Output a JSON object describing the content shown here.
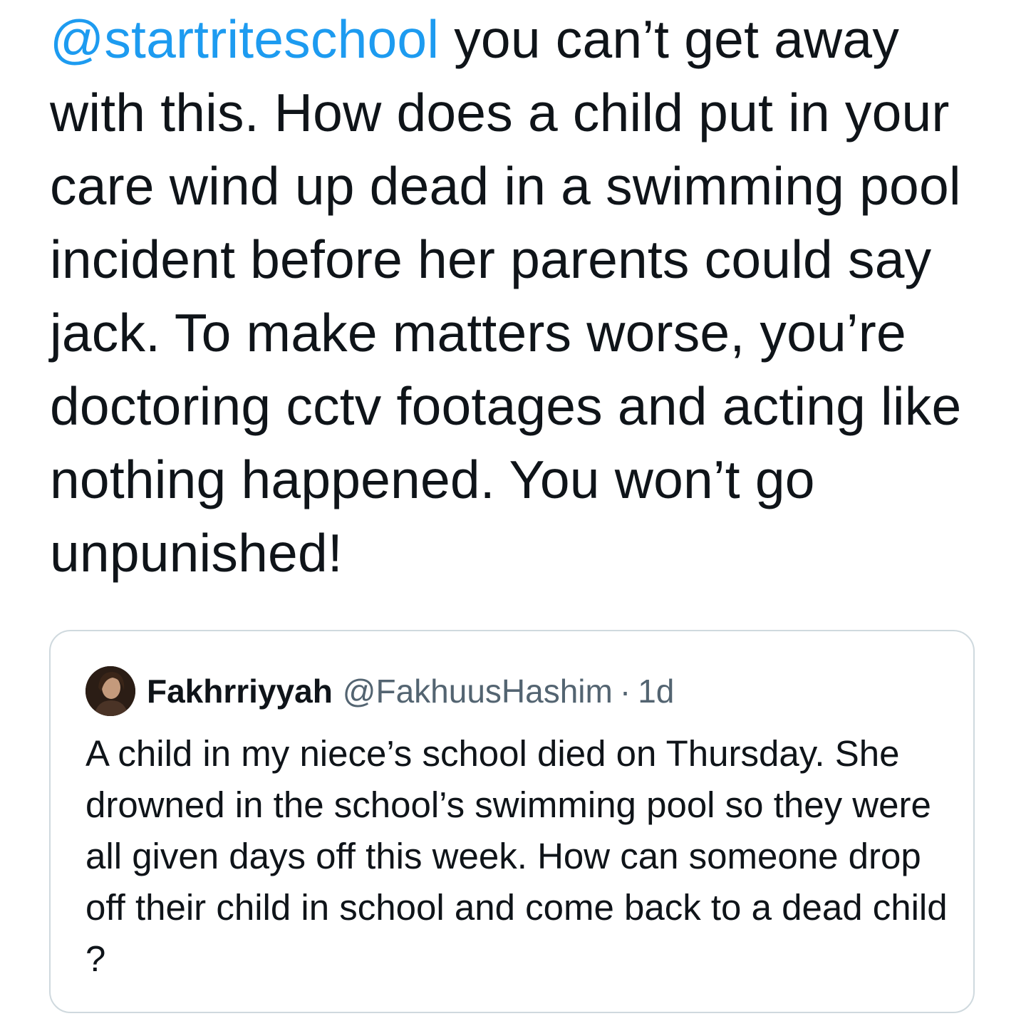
{
  "tweet": {
    "mention": "@startriteschool",
    "text": " you can’t get away with this. How does a child put in your care wind up dead in a swimming pool incident before her parents could say jack. To make matters worse, you’re doctoring cctv footages and acting like nothing happened. You won’t go unpunished!"
  },
  "quoted_tweet": {
    "display_name": "Fakhrriyyah",
    "handle": "@FakhuusHashim",
    "separator": "·",
    "time": "1d",
    "avatar_icon": "user-avatar",
    "text": "A child in my niece’s school died on Thursday. She drowned in the school’s swimming pool so they were all given days off this week. How can someone drop off their child in school and come back to a dead child ?"
  },
  "colors": {
    "mention": "#1d9bf0",
    "text": "#0f1419",
    "secondary": "#536471",
    "border": "#cfd9de"
  }
}
